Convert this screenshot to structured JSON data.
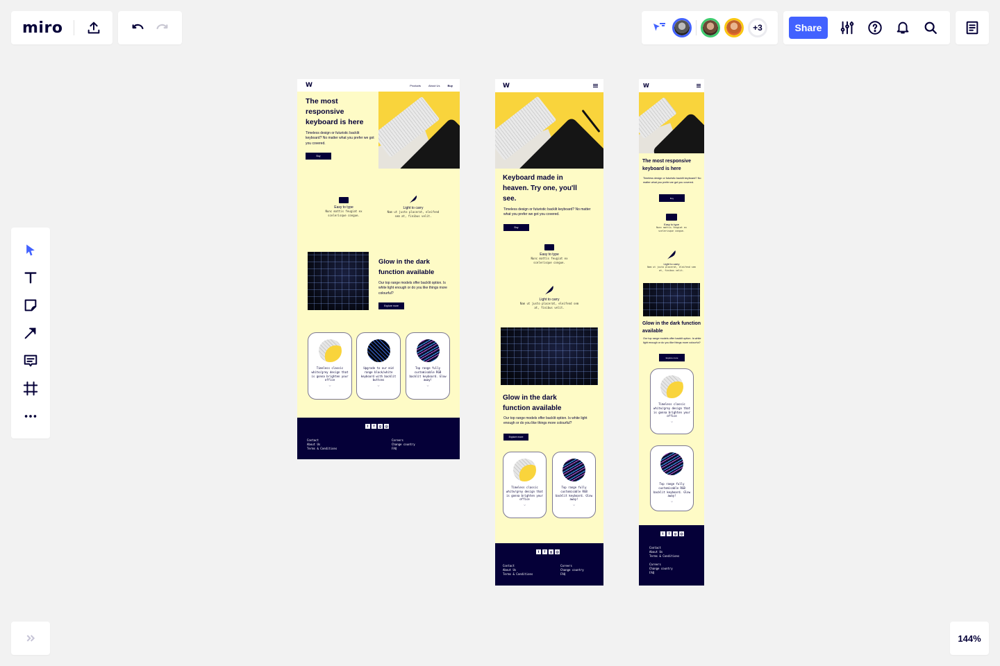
{
  "app": {
    "logo": "miro",
    "share_label": "Share",
    "more_collaborators": "+3",
    "zoom_level": "144%",
    "accent_color": "#4262ff",
    "collaborators": [
      {
        "name": "collaborator-1",
        "ring_color": "#4262ff"
      },
      {
        "name": "collaborator-2",
        "ring_color": "#3ecb6e"
      },
      {
        "name": "collaborator-3",
        "ring_color": "#fac710"
      }
    ],
    "toolbar_icons": [
      "select-icon",
      "text-icon",
      "sticky-note-icon",
      "arrow-line-icon",
      "comment-icon",
      "frame-icon",
      "more-icon"
    ]
  },
  "desktop": {
    "logo": "W",
    "nav": [
      "Products",
      "About Us",
      "Buy"
    ],
    "hero_title": "The most responsive keyboard is here",
    "hero_text": "Timeless design or futuristic backlit keyboard? No matter what you prefer we got you covered.",
    "hero_button": "Buy",
    "features": [
      {
        "title": "Easy to type",
        "text": "Nunc mattis feugiat ex scelerisque congue."
      },
      {
        "title": "Light to carry",
        "text": "Nam ut justo placerat, eleifend sem at, finibus velit."
      }
    ],
    "glow_title": "Glow in the dark function available",
    "glow_text": "Our top range models offer backlit option. Is white light enough or do you like things more colourful?",
    "glow_button": "Explore more",
    "cards": [
      "Timeless classic white/grey design that is gonna brighten your office",
      "Upgrade to our mid range black/white keyboard with backlit buttons",
      "Top range fully customisable RGB backlit keyboard. Glow away!"
    ],
    "socials": [
      "twitter",
      "facebook",
      "google-plus",
      "instagram"
    ],
    "footer_left": [
      "Contact",
      "About Us",
      "Terms & Conditions"
    ],
    "footer_right": [
      "Careers",
      "Change country",
      "FAQ"
    ]
  },
  "tablet": {
    "logo": "W",
    "hero_title": "Keyboard made in heaven. Try one, you'll see.",
    "hero_text": "Timeless design or futuristic backlit keyboard? No matter what you prefer we got you covered.",
    "hero_button": "Buy",
    "features": [
      {
        "title": "Easy to type",
        "text": "Nunc mattis feugiat ex scelerisque congue."
      },
      {
        "title": "Light to carry",
        "text": "Nam ut justo placerat, eleifend sem at, finibus velit."
      }
    ],
    "glow_title": "Glow in the dark function available",
    "glow_text": "Our top range models offer backlit option. Is white light enough or do you like things more colourful?",
    "glow_button": "Explore more",
    "cards": [
      "Timeless classic white/grey design that is gonna brighten your office",
      "Top range fully customisable RGB backlit keyboard. Glow away!"
    ],
    "footer_left": [
      "Contact",
      "About Us",
      "Terms & Conditions"
    ],
    "footer_right": [
      "Careers",
      "Change country",
      "FAQ"
    ]
  },
  "mobile": {
    "logo": "W",
    "hero_title": "The most responsive keyboard is here",
    "hero_text": "Timeless design or futuristic backlit keyboard? No matter what you prefer we got you covered.",
    "hero_button": "Buy",
    "features": [
      {
        "title": "Easy to type",
        "text": "Nunc mattis feugiat ex scelerisque congue."
      },
      {
        "title": "Light to carry",
        "text": "Nam ut justo placerat, eleifend sem at, finibus velit."
      }
    ],
    "glow_title": "Glow in the dark function available",
    "glow_text": "Our top range models offer backlit option. Is white light enough or do you like things more colourful?",
    "glow_button": "Explore more",
    "cards": [
      "Timeless classic white/grey design that is gonna brighten your office",
      "Top range fully customisable RGB backlit keyboard. Glow away!"
    ],
    "footer_left": [
      "Contact",
      "About Us",
      "Terms & Conditions"
    ],
    "footer_right": [
      "Careers",
      "Change country",
      "FAQ"
    ]
  }
}
